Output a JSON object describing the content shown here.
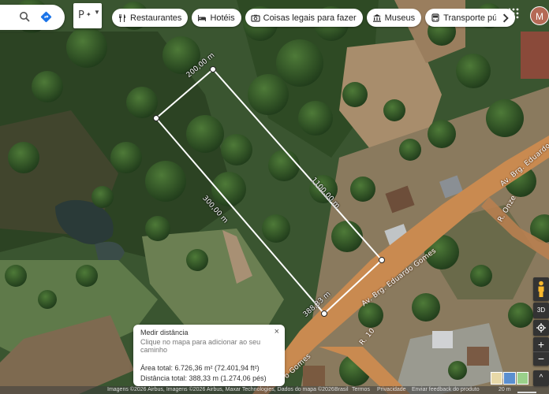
{
  "toolbar": {
    "layers_label": "P",
    "chips": [
      {
        "label": "Restaurantes",
        "icon": "fork-knife-icon"
      },
      {
        "label": "Hotéis",
        "icon": "bed-icon"
      },
      {
        "label": "Coisas legais para fazer",
        "icon": "camera-icon"
      },
      {
        "label": "Museus",
        "icon": "museum-icon"
      },
      {
        "label": "Transporte públic",
        "icon": "bus-icon"
      }
    ],
    "avatar_initial": "M"
  },
  "measure": {
    "segments": [
      "200,00 m",
      "1100,00 m",
      "300,00 m",
      "388,33 m"
    ]
  },
  "roads": {
    "main": "Av. Brg. Eduardo Gomes",
    "main_short": "o Gomes",
    "main_top": "Av. Brg. Eduardo",
    "onze": "R. Onze",
    "r10": "R. 10"
  },
  "card": {
    "title": "Medir distância",
    "subtitle": "Clique no mapa para adicionar ao seu caminho",
    "area": "Área total: 6.726,36 m² (72.401,94 ft²)",
    "distance": "Distância total: 388,33 m (1.274,06 pés)",
    "close": "×"
  },
  "controls": {
    "tilt": "3D",
    "zoom_in": "+",
    "zoom_out": "−",
    "expand": "^"
  },
  "attribution": {
    "imagery": "Imagens ©2026 Airbus, Imagens ©2026 Airbus, Maxar Technologies, Dados do mapa ©2026",
    "country": "Brasil",
    "terms": "Termos",
    "privacy": "Privacidade",
    "feedback": "Enviar feedback do produto",
    "scale": "20 m"
  },
  "colors": {
    "road": "#c98a50",
    "measure": "#ffffff"
  }
}
